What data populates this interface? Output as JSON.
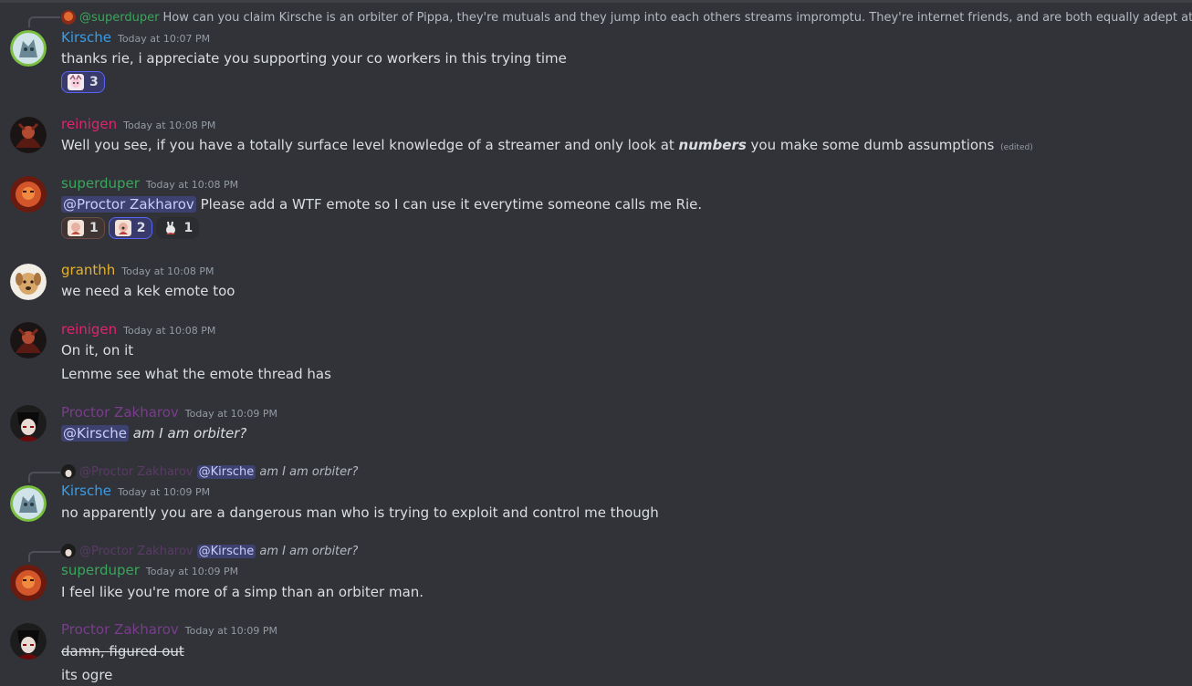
{
  "colors": {
    "background": "#313338",
    "kirsche": "#3b9ce5",
    "reinigen": "#e0246b",
    "superduper": "#3ba55c",
    "granthh": "#e4b12f",
    "proctor": "#7a3c8c",
    "mention_bg": "#4a4f8a"
  },
  "messages": [
    {
      "reply": {
        "author": "@superduper",
        "text": "How can you claim Kirsche is an orbiter of Pippa, they're mutuals and they jump into each others streams impromptu. They're internet friends, and are both equally adept at enhancing each o"
      },
      "author": "Kirsche",
      "timestamp": "Today at 10:07 PM",
      "lines": [
        "thanks rie, i appreciate you supporting your co workers in this trying time"
      ],
      "reactions": [
        {
          "icon": "pippa-emote-icon",
          "count": "3"
        }
      ]
    },
    {
      "author": "reinigen",
      "timestamp": "Today at 10:08 PM",
      "lines": [
        {
          "before": "Well you see, if you have a totally surface level knowledge of a streamer and only look at ",
          "emph": "numbers",
          "after": " you make some dumb assumptions",
          "edited": "(edited)"
        }
      ]
    },
    {
      "author": "superduper",
      "timestamp": "Today at 10:08 PM",
      "mention": "@Proctor Zakharov",
      "lines": [
        " Please add a WTF emote so I can use it everytime someone calls me Rie."
      ],
      "reactions": [
        {
          "icon": "rie-emote-icon",
          "count": "1"
        },
        {
          "icon": "rie-wtf-emote-icon",
          "count": "2"
        },
        {
          "icon": "rabbit-emote-icon",
          "count": "1"
        }
      ]
    },
    {
      "author": "granthh",
      "timestamp": "Today at 10:08 PM",
      "lines": [
        "we need a kek emote too"
      ]
    },
    {
      "author": "reinigen",
      "timestamp": "Today at 10:08 PM",
      "lines": [
        "On it, on it",
        "Lemme see what the emote thread has"
      ]
    },
    {
      "author": "Proctor Zakharov",
      "timestamp": "Today at 10:09 PM",
      "mention": "@Kirsche",
      "lines": [
        " am I am orbiter?"
      ]
    },
    {
      "reply": {
        "author": "@Proctor Zakharov",
        "mention": "@Kirsche",
        "text": "am I am orbiter?"
      },
      "author": "Kirsche",
      "timestamp": "Today at 10:09 PM",
      "lines": [
        "no apparently you are a dangerous man who is trying to exploit and control me though"
      ]
    },
    {
      "reply": {
        "author": "@Proctor Zakharov",
        "mention": "@Kirsche",
        "text": "am I am orbiter?"
      },
      "author": "superduper",
      "timestamp": "Today at 10:09 PM",
      "lines": [
        "I feel like you're more of a simp than an orbiter man."
      ]
    },
    {
      "author": "Proctor Zakharov",
      "timestamp": "Today at 10:09 PM",
      "lines": [
        "damn, figured out",
        "its ogre"
      ]
    }
  ]
}
